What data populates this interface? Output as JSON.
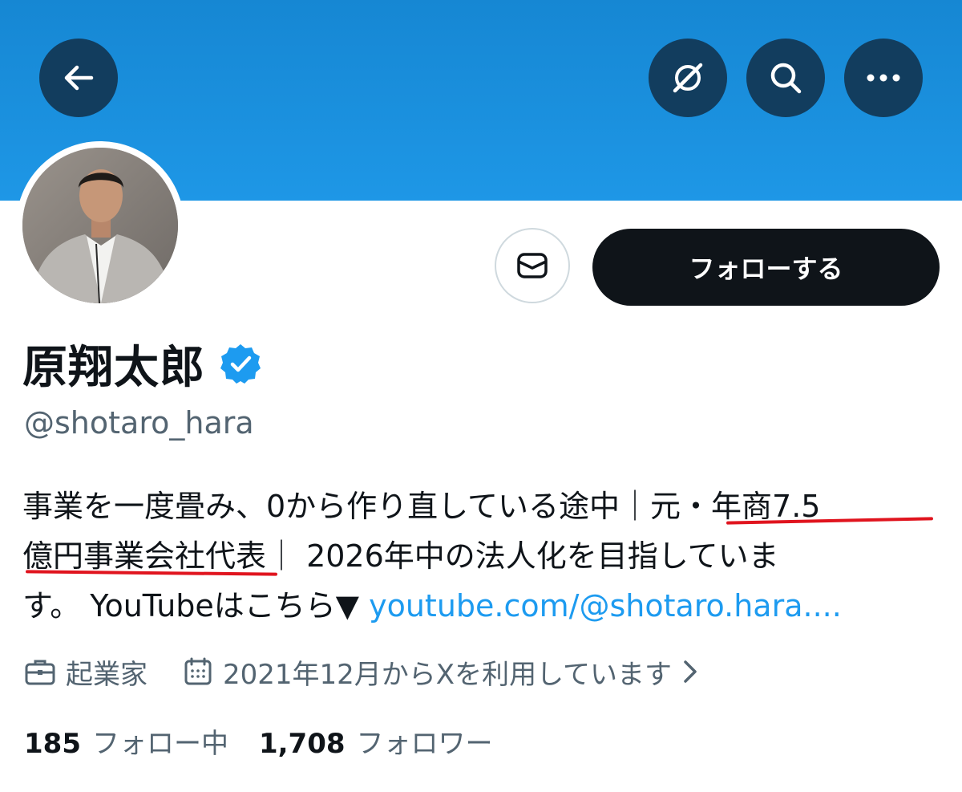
{
  "header": {
    "back_icon": "arrow-left-icon",
    "grok_icon": "grok-icon",
    "search_icon": "search-icon",
    "more_icon": "more-horizontal-icon",
    "banner_color": "#1e97e6"
  },
  "profile": {
    "display_name": "原翔太郎",
    "handle": "@shotaro_hara",
    "verified_icon": "verified-badge-icon",
    "verified_color": "#1d9bf0"
  },
  "actions": {
    "message_icon": "envelope-icon",
    "follow_label": "フォローする"
  },
  "bio": {
    "line1_text": "事業を一度畳み、0から作り直している途中｜元・年商7.5",
    "line2_text": "億円事業会社代表｜ 2026年中の法人化を目指していま",
    "line3_text": "す。 YouTubeはこちら▼ ",
    "link": "youtube.com/@shotaro.hara....",
    "highlight_color": "#e0141e"
  },
  "meta": {
    "category_icon": "briefcase-icon",
    "category": "起業家",
    "joined_icon": "calendar-icon",
    "joined": "2021年12月からXを利用しています"
  },
  "stats": {
    "following_count": "185",
    "following_label": "フォロー中",
    "followers_count": "1,708",
    "followers_label": "フォロワー"
  }
}
